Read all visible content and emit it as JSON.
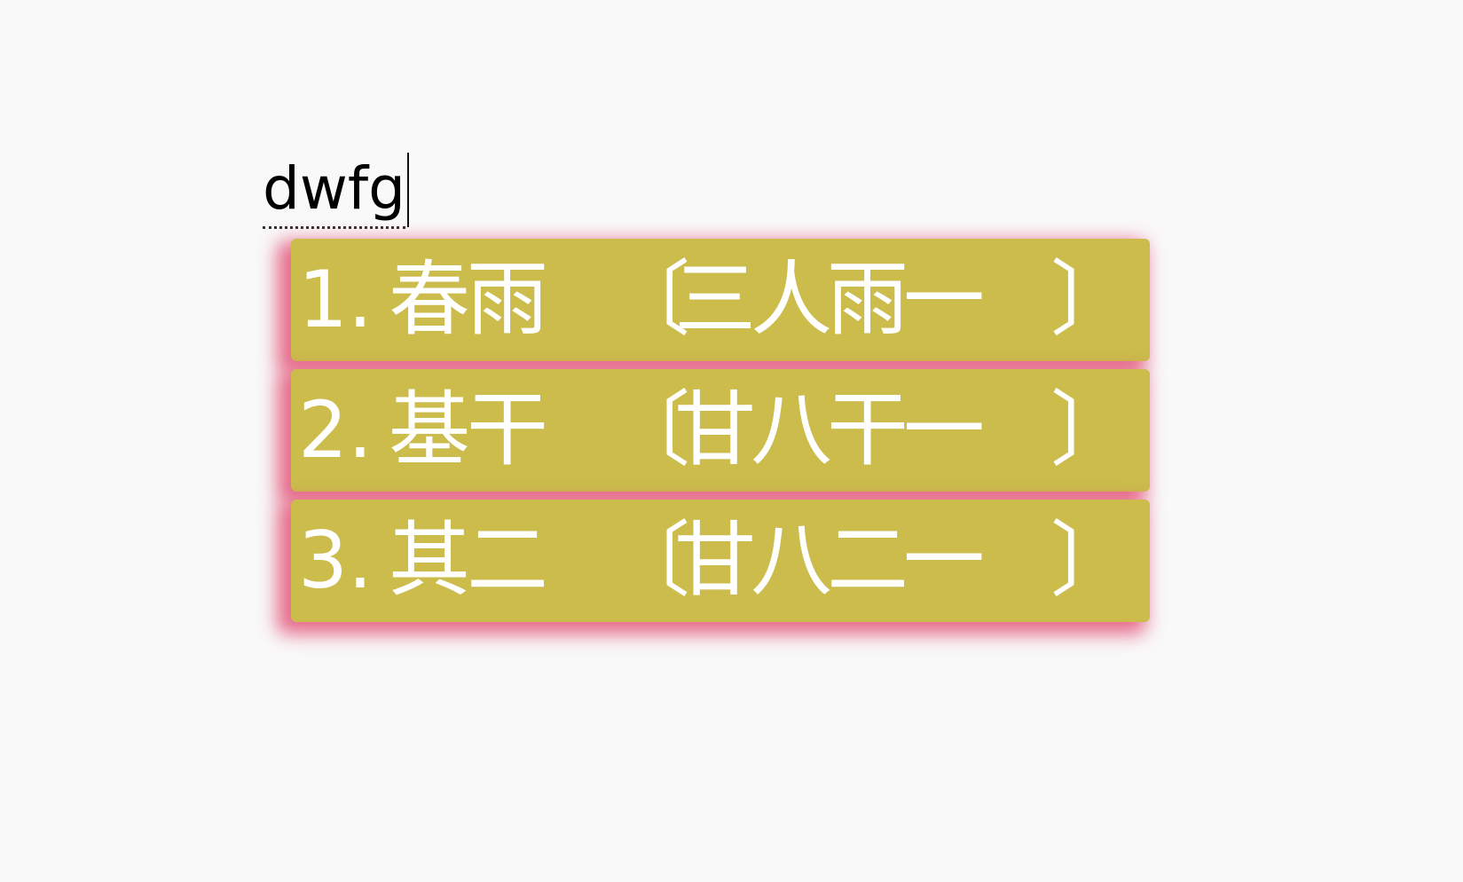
{
  "composition": {
    "text": "dwfg"
  },
  "candidates": [
    {
      "index": "1.",
      "text": "春雨",
      "open": "〔",
      "code": "三人雨一",
      "close": "〕"
    },
    {
      "index": "2.",
      "text": "基干",
      "open": "〔",
      "code": "甘八干一",
      "close": "〕"
    },
    {
      "index": "3.",
      "text": "其二",
      "open": "〔",
      "code": "甘八二一",
      "close": "〕"
    }
  ],
  "colors": {
    "background": "#f9f9f9",
    "candidate_bg": "#cbbc4c",
    "candidate_glow": "#e2466e",
    "candidate_text": "#ffffff",
    "composition_text": "#000000"
  }
}
